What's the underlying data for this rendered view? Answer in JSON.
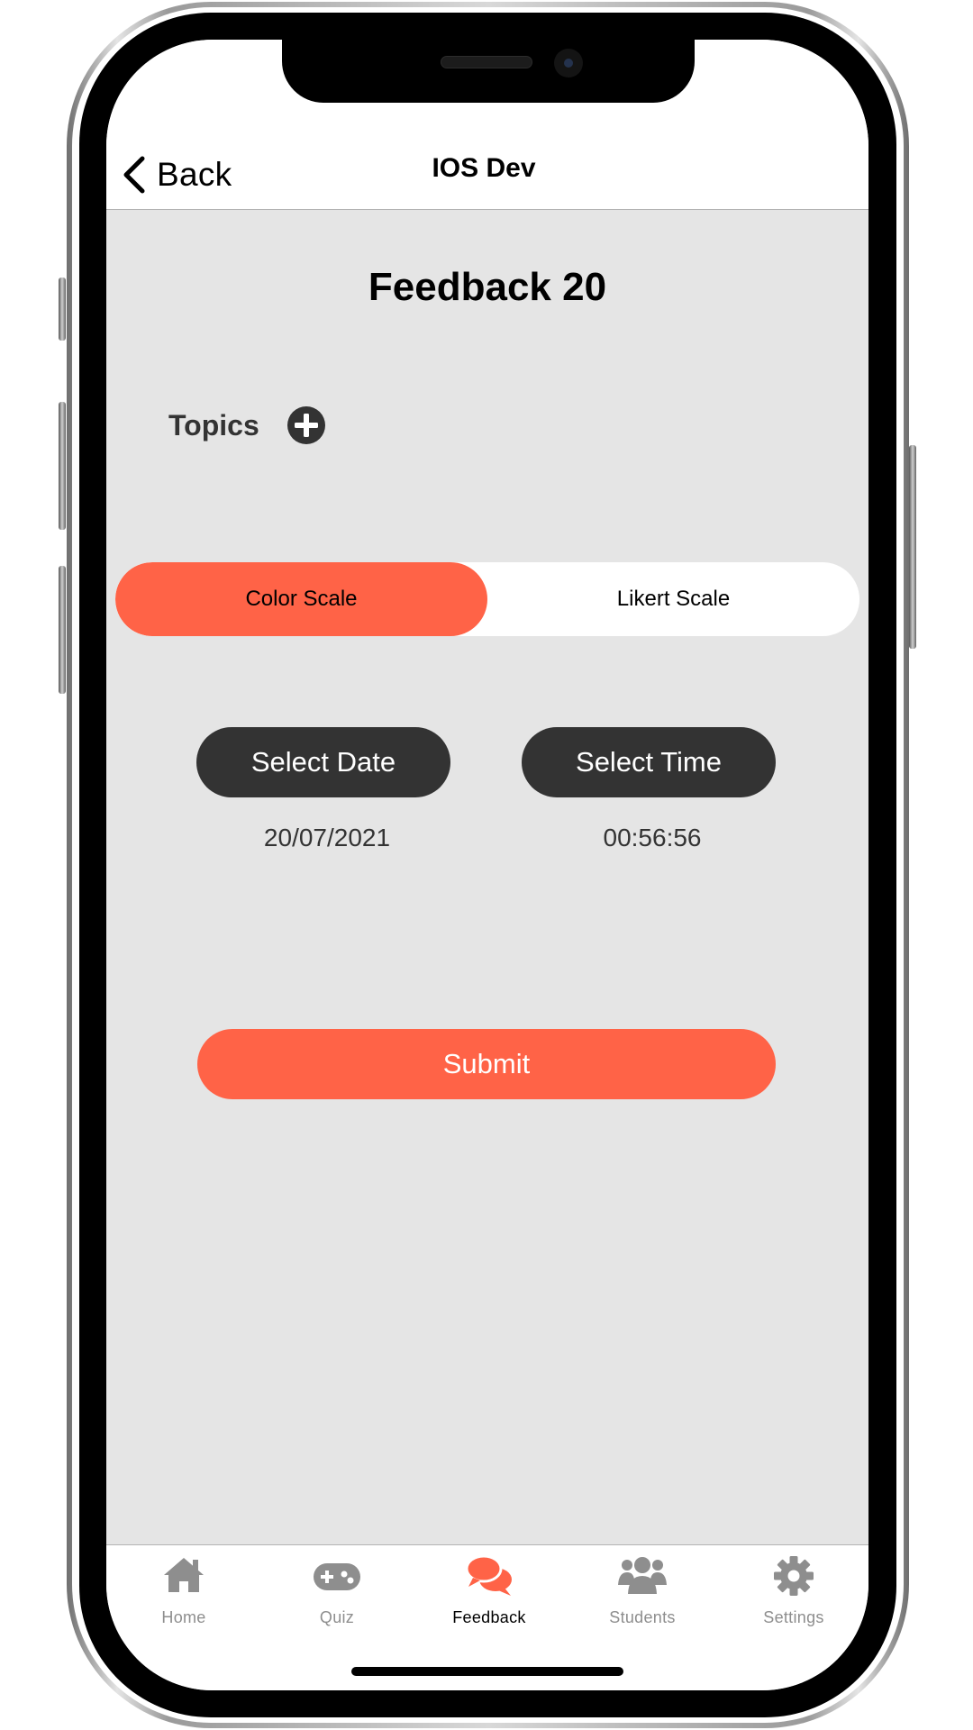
{
  "nav": {
    "back_label": "Back",
    "title": "IOS Dev"
  },
  "main": {
    "heading": "Feedback 20",
    "topics_label": "Topics",
    "scale_options": [
      "Color Scale",
      "Likert Scale"
    ],
    "selected_scale": "Color Scale",
    "select_date_label": "Select Date",
    "select_time_label": "Select Time",
    "date_value": "20/07/2021",
    "time_value": "00:56:56",
    "submit_label": "Submit"
  },
  "tabs": [
    {
      "label": "Home",
      "icon": "home-icon",
      "active": false
    },
    {
      "label": "Quiz",
      "icon": "gamepad-icon",
      "active": false
    },
    {
      "label": "Feedback",
      "icon": "chat-bubbles-icon",
      "active": true
    },
    {
      "label": "Students",
      "icon": "users-icon",
      "active": false
    },
    {
      "label": "Settings",
      "icon": "gear-icon",
      "active": false
    }
  ],
  "colors": {
    "accent": "#ff6347",
    "dark_button": "#333333",
    "background": "#e5e5e5",
    "tab_inactive": "#8e8e8e"
  }
}
